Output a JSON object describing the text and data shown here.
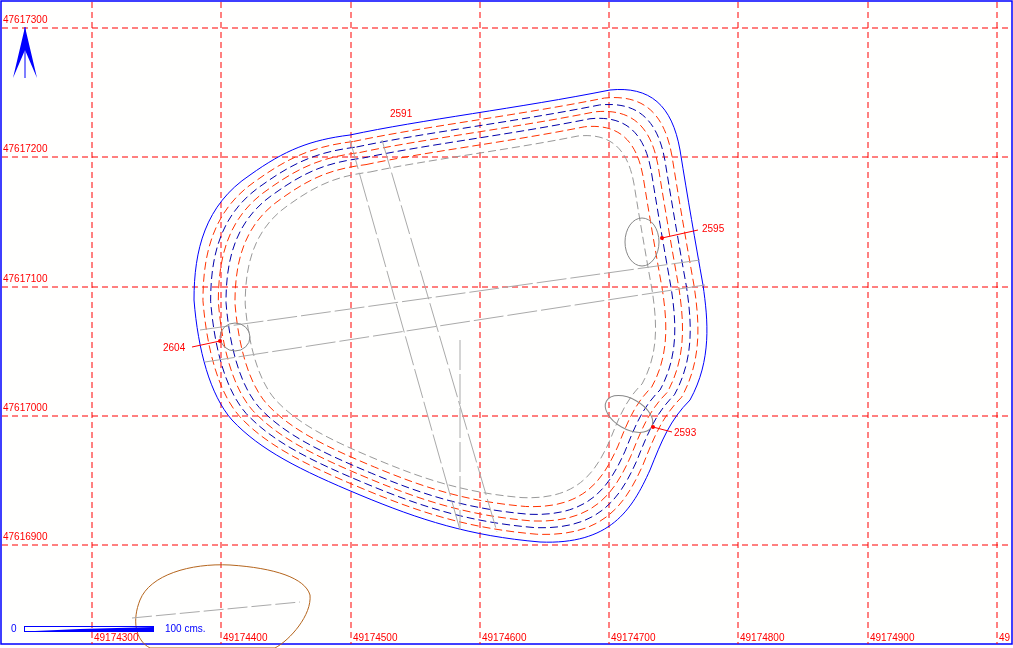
{
  "y_axis_labels": [
    "47617300",
    "47617200",
    "47617100",
    "47617000",
    "47616900"
  ],
  "x_axis_labels": [
    "49174300",
    "49174400",
    "49174500",
    "49174600",
    "49174700",
    "49174800",
    "49174900",
    "49"
  ],
  "feature_labels": [
    {
      "text": "2591",
      "kind": "plain"
    },
    {
      "text": "2595",
      "kind": "arrow"
    },
    {
      "text": "2604",
      "kind": "arrow"
    },
    {
      "text": "2593",
      "kind": "arrow"
    }
  ],
  "scale_bar": {
    "start": "0",
    "end": "100 cms."
  }
}
